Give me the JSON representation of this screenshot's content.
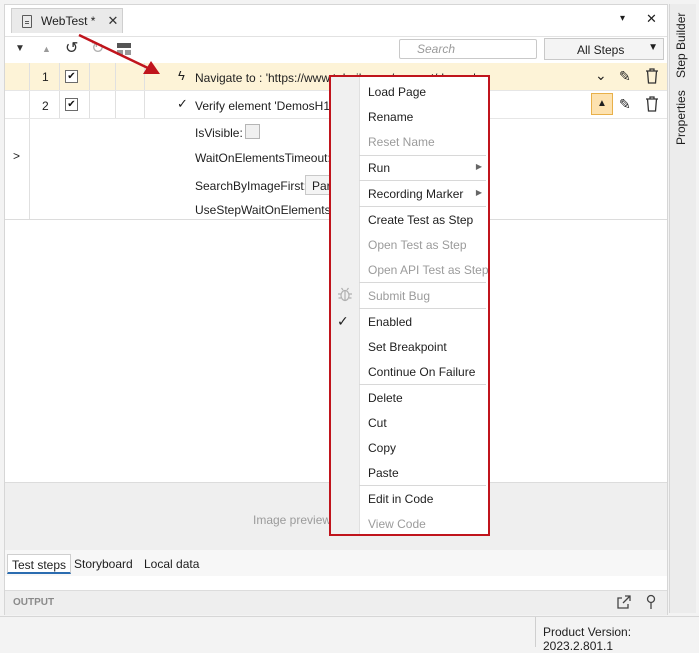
{
  "tab": {
    "title": "WebTest *",
    "close": "✕"
  },
  "window_controls": {
    "menu": "▾",
    "close": "✕"
  },
  "toolbar": {
    "collapse_icon": "▼",
    "up_icon": "▲",
    "undo_icon": "↺",
    "redo_icon": "↻",
    "search_placeholder": "Search",
    "filter_value": "All Steps"
  },
  "steps": [
    {
      "number": "1",
      "checked": "✔",
      "text": "Navigate to : 'https://www.telerik.com/support/demos'"
    },
    {
      "number": "2",
      "checked": "✔",
      "text": "Verify element 'DemosH1'"
    }
  ],
  "properties": {
    "is_visible_label": "IsVisible:",
    "wait_timeout_label": "WaitOnElementsTimeout:",
    "search_by_image_label": "SearchByImageFirst:",
    "search_by_image_value": "Par",
    "use_step_wait_label": "UseStepWaitOnElements:"
  },
  "image_preview": {
    "text": "Image preview"
  },
  "bottom_tabs": [
    "Test steps",
    "Storyboard",
    "Local data"
  ],
  "output": {
    "title": "OUTPUT"
  },
  "side_tabs": {
    "step_builder": "Step Builder",
    "properties": "Properties"
  },
  "status": {
    "product_version": "Product Version: 2023.2.801.1"
  },
  "context_menu": {
    "items": [
      {
        "label": "Load Page"
      },
      {
        "label": "Rename"
      },
      {
        "label": "Reset Name"
      },
      {
        "label": "Run"
      },
      {
        "label": "Recording Marker"
      },
      {
        "label": "Create Test as Step"
      },
      {
        "label": "Open Test as Step"
      },
      {
        "label": "Open API Test as Step"
      },
      {
        "label": "Submit Bug"
      },
      {
        "label": "Enabled"
      },
      {
        "label": "Set Breakpoint"
      },
      {
        "label": "Continue On Failure"
      },
      {
        "label": "Delete"
      },
      {
        "label": "Cut"
      },
      {
        "label": "Copy"
      },
      {
        "label": "Paste"
      },
      {
        "label": "Edit in Code"
      },
      {
        "label": "View Code"
      }
    ],
    "enabled_check": "✓",
    "submenu_arrow": "▶"
  },
  "colors": {
    "selected_row": "#fdf3d7",
    "menu_border": "#c0141c",
    "annotation_arrow": "#c0141c"
  }
}
